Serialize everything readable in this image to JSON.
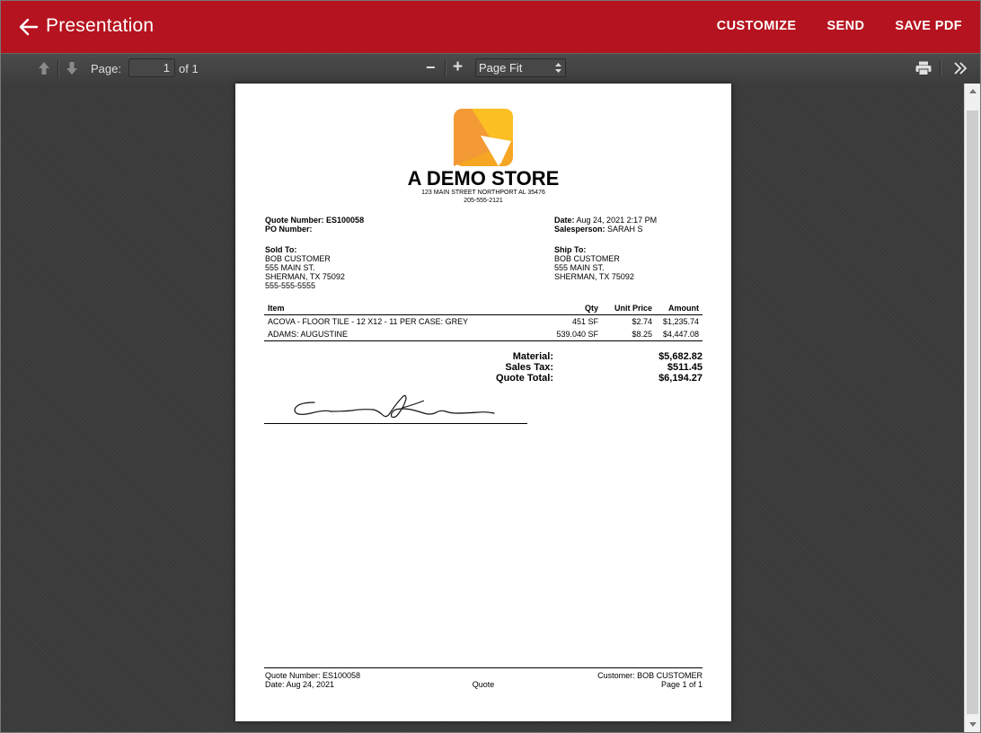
{
  "appbar": {
    "title": "Presentation",
    "actions": [
      "CUSTOMIZE",
      "SEND",
      "SAVE PDF"
    ],
    "color": "#b5131f"
  },
  "toolbar": {
    "page_label": "Page:",
    "page_value": "1",
    "page_of": "of 1",
    "zoom_out": "−",
    "zoom_in": "+",
    "zoom_value": "Page Fit",
    "icons": [
      "arrow-up-icon",
      "arrow-down-icon",
      "print-icon",
      "double-chevron-right-icon"
    ]
  },
  "document": {
    "store_name": "A DEMO STORE",
    "store_address": "123 MAIN STREET NORTHPORT AL 35476",
    "store_phone": "205-555-2121",
    "quote_number_label": "Quote Number:",
    "quote_number": "ES100058",
    "po_number_label": "PO Number:",
    "date_label": "Date:",
    "date": "Aug 24, 2021 2:17 PM",
    "salesperson_label": "Salesperson:",
    "salesperson": "SARAH S",
    "sold_to_label": "Sold To:",
    "sold_to": [
      "BOB CUSTOMER",
      "555 MAIN ST.",
      "SHERMAN, TX 75092",
      "555-555-5555"
    ],
    "ship_to_label": "Ship To:",
    "ship_to": [
      "BOB CUSTOMER",
      "555 MAIN ST.",
      "SHERMAN, TX 75092"
    ],
    "table_headers": {
      "item": "Item",
      "qty": "Qty",
      "unit_price": "Unit Price",
      "amount": "Amount"
    },
    "rows": [
      {
        "item": "ACOVA - FLOOR TILE - 12 X12 - 11 PER CASE: GREY",
        "qty": "451 SF",
        "unit_price": "$2.74",
        "amount": "$1,235.74"
      },
      {
        "item": "ADAMS: AUGUSTINE",
        "qty": "539.040 SF",
        "unit_price": "$8.25",
        "amount": "$4,447.08"
      }
    ],
    "totals": {
      "material_label": "Material:",
      "material": "$5,682.82",
      "sales_tax_label": "Sales Tax:",
      "sales_tax": "$511.45",
      "quote_total_label": "Quote Total:",
      "quote_total": "$6,194.27"
    },
    "footer": {
      "quote_number": "Quote Number: ES100058",
      "date": "Date: Aug 24, 2021",
      "doc_type": "Quote",
      "customer": "Customer: BOB CUSTOMER",
      "page": "Page 1 of 1"
    }
  }
}
